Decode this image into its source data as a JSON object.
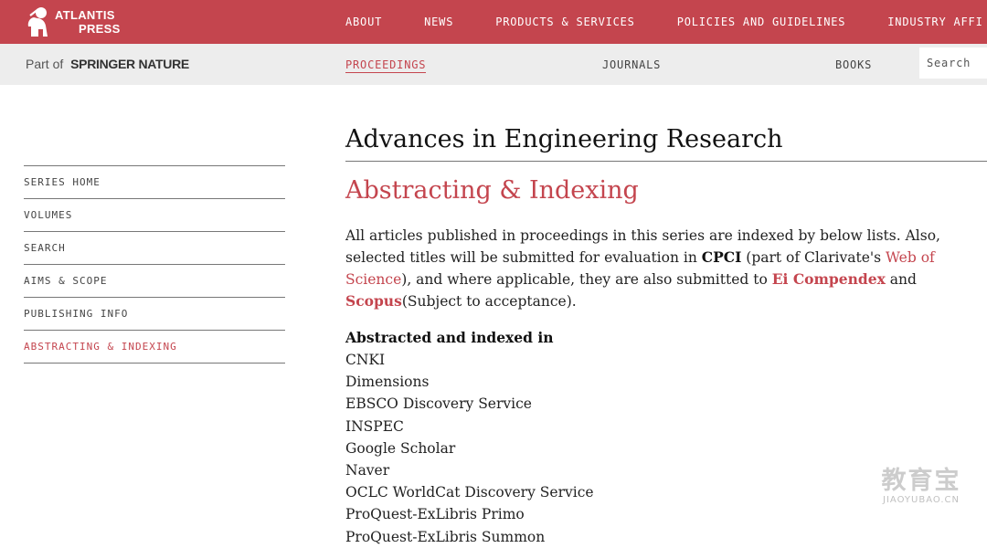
{
  "header": {
    "logo_line1": "ATLANTIS",
    "logo_line2": "PRESS",
    "nav": [
      {
        "label": "ABOUT"
      },
      {
        "label": "NEWS"
      },
      {
        "label": "PRODUCTS & SERVICES"
      },
      {
        "label": "POLICIES AND GUIDELINES"
      },
      {
        "label": "INDUSTRY AFFI"
      }
    ],
    "brand_color": "#c4454e"
  },
  "subbar": {
    "part_of": "Part of",
    "parent_brand": "SPRINGER NATURE",
    "nav": [
      {
        "label": "PROCEEDINGS",
        "active": true
      },
      {
        "label": "JOURNALS",
        "active": false
      },
      {
        "label": "BOOKS",
        "active": false
      }
    ],
    "search_placeholder": "Search"
  },
  "sidebar": {
    "items": [
      {
        "label": "SERIES HOME",
        "active": false
      },
      {
        "label": "VOLUMES",
        "active": false
      },
      {
        "label": "SEARCH",
        "active": false
      },
      {
        "label": "AIMS & SCOPE",
        "active": false
      },
      {
        "label": "PUBLISHING INFO",
        "active": false
      },
      {
        "label": "ABSTRACTING & INDEXING",
        "active": true
      }
    ]
  },
  "main": {
    "series_title": "Advances in Engineering Research",
    "page_title": "Abstracting & Indexing",
    "intro": {
      "p1": "All articles published in proceedings in this series are indexed by below lists. Also, selected titles will be submitted for evaluation in ",
      "cpci": "CPCI",
      "p2": " (part of Clarivate's ",
      "wos": "Web of Science",
      "p3": "), and where applicable, they are also submitted to ",
      "ei": "Ei Compendex",
      "p4": " and ",
      "scopus": "Scopus",
      "p5": "(Subject to acceptance)."
    },
    "list_heading": "Abstracted and indexed in",
    "index_items": [
      "CNKI",
      "Dimensions",
      "EBSCO Discovery Service",
      "INSPEC",
      "Google Scholar",
      "Naver",
      "OCLC WorldCat Discovery Service",
      "ProQuest-ExLibris Primo",
      "ProQuest-ExLibris Summon"
    ]
  },
  "watermark": {
    "cn": "教育宝",
    "en": "JIAOYUBAO.CN"
  }
}
